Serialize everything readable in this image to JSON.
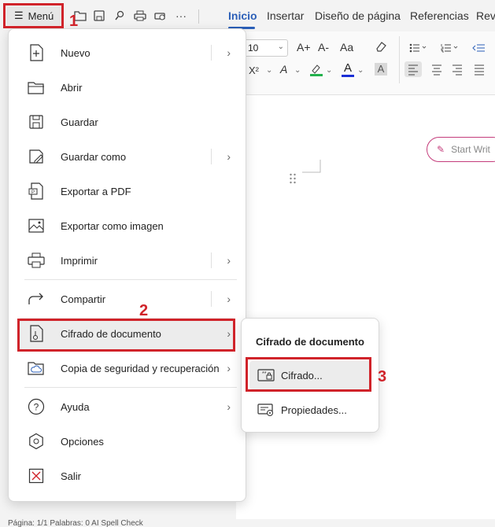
{
  "menu_button": {
    "label": "Menú",
    "icon": "hamburger-icon"
  },
  "quick_access": [
    {
      "name": "open-folder-icon"
    },
    {
      "name": "save-icon"
    },
    {
      "name": "format-painter-icon"
    },
    {
      "name": "print-icon"
    },
    {
      "name": "print-preview-icon"
    },
    {
      "more": "···"
    }
  ],
  "tabs": [
    {
      "label": "Inicio",
      "active": true
    },
    {
      "label": "Insertar"
    },
    {
      "label": "Diseño de página"
    },
    {
      "label": "Referencias"
    },
    {
      "label": "Revi"
    }
  ],
  "ribbon": {
    "font_size": "10",
    "buttons": [
      "A+",
      "A-",
      "Aa",
      "X²",
      "A"
    ]
  },
  "menu_items": [
    {
      "label": "Nuevo",
      "icon": "new-document-icon",
      "has_submenu": true
    },
    {
      "label": "Abrir",
      "icon": "open-folder-icon"
    },
    {
      "label": "Guardar",
      "icon": "save-icon"
    },
    {
      "label": "Guardar como",
      "icon": "save-as-icon",
      "has_submenu": true
    },
    {
      "label": "Exportar a PDF",
      "icon": "export-pdf-icon"
    },
    {
      "label": "Exportar como imagen",
      "icon": "export-image-icon"
    },
    {
      "label": "Imprimir",
      "icon": "print-icon",
      "has_submenu": true
    },
    {
      "label": "Compartir",
      "icon": "share-icon",
      "has_submenu": true
    },
    {
      "label": "Cifrado de documento",
      "icon": "document-encryption-icon",
      "has_submenu": true,
      "highlighted": true
    },
    {
      "label": "Copia de seguridad y recuperación",
      "icon": "cloud-backup-icon",
      "has_submenu": true
    },
    {
      "label": "Ayuda",
      "icon": "help-icon",
      "has_submenu": true
    },
    {
      "label": "Opciones",
      "icon": "options-icon"
    },
    {
      "label": "Salir",
      "icon": "exit-icon"
    }
  ],
  "submenu": {
    "title": "Cifrado de documento",
    "items": [
      {
        "label": "Cifrado...",
        "icon": "encryption-password-icon",
        "highlighted": true
      },
      {
        "label": "Propiedades...",
        "icon": "properties-icon"
      }
    ]
  },
  "annotations": {
    "step1": "1",
    "step2": "2",
    "step3": "3",
    "accent": "#d0232a"
  },
  "start_writing": {
    "label": "Start Writ"
  },
  "status": {
    "text": "Página: 1/1   Palabras: 0   AI Spell Check"
  }
}
